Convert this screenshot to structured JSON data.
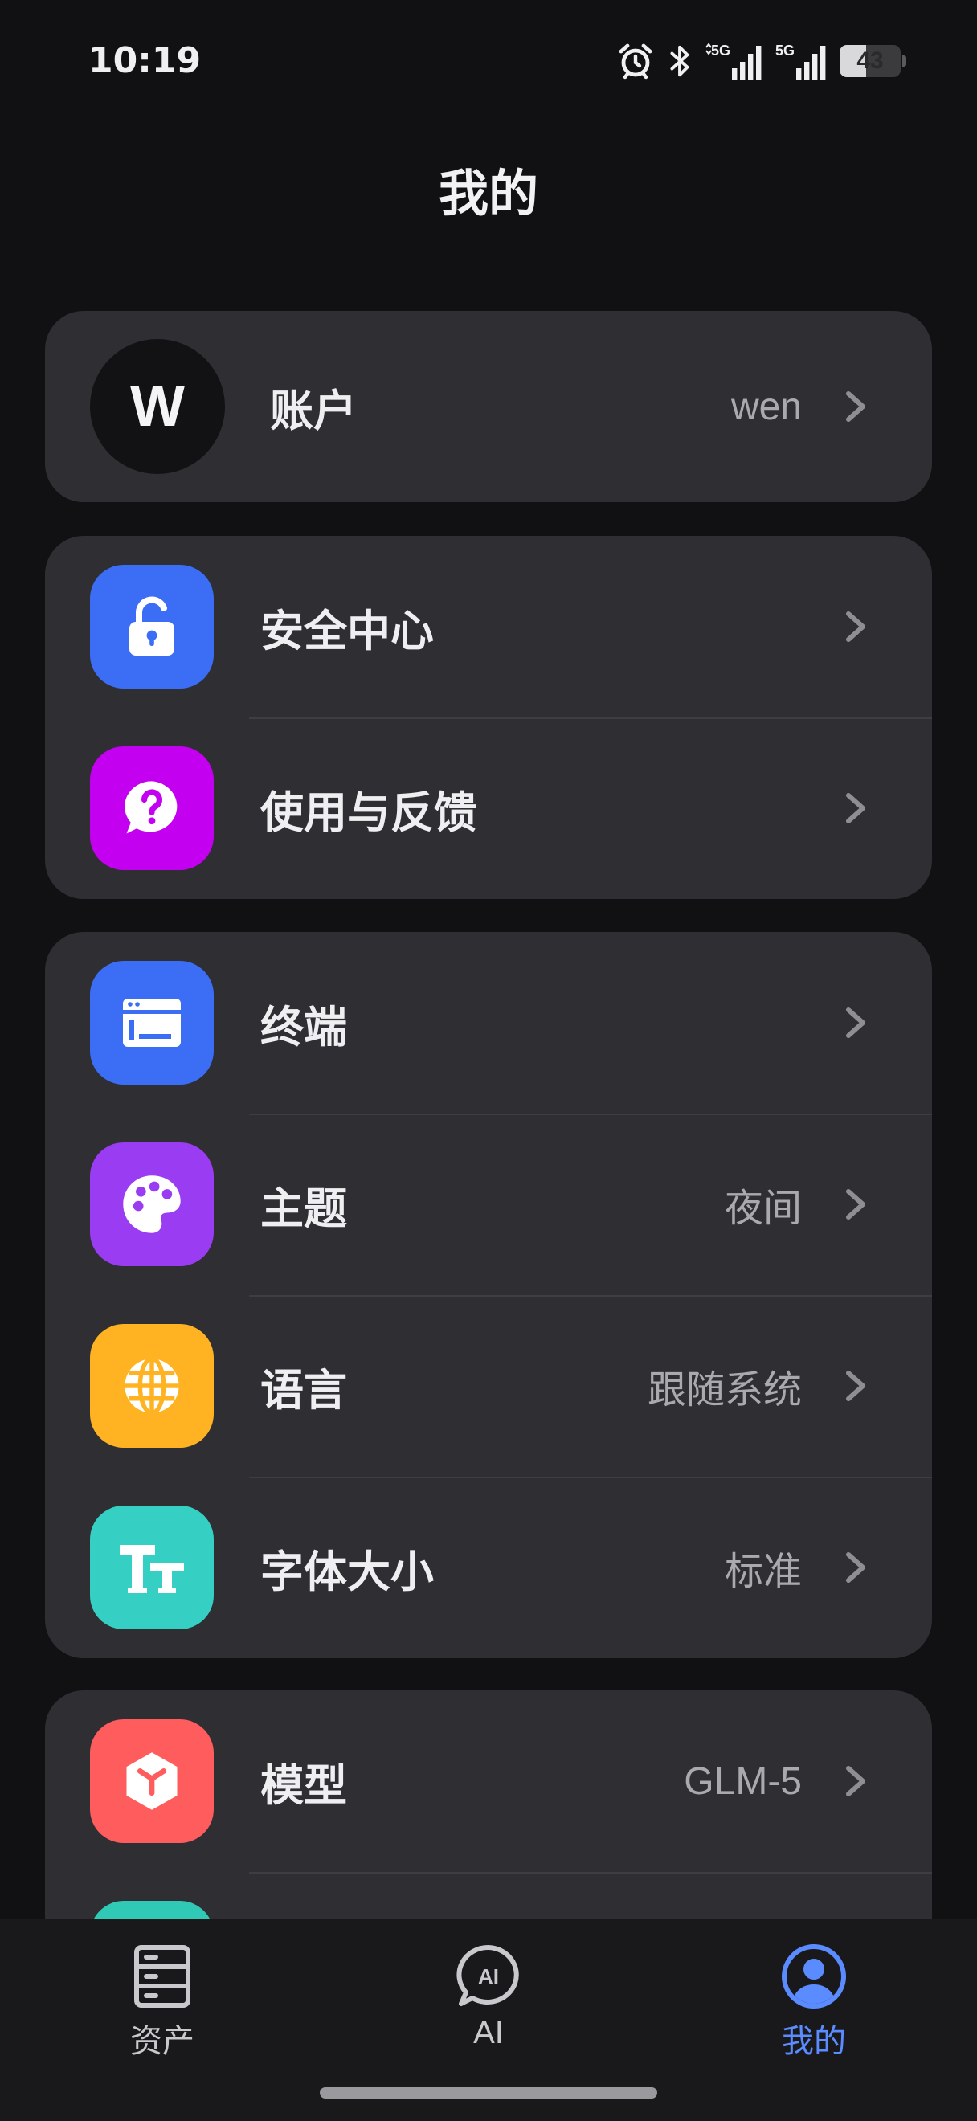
{
  "status_bar": {
    "time": "10:19",
    "battery_level": "43",
    "icons": [
      "alarm-icon",
      "bluetooth-icon",
      "signal-5g-icon",
      "signal-5g-icon",
      "battery-icon"
    ]
  },
  "page": {
    "title": "我的"
  },
  "account": {
    "avatar_letter": "W",
    "label": "账户",
    "value": "wen"
  },
  "groups": [
    {
      "items": [
        {
          "label": "安全中心",
          "value": "",
          "icon": "unlock-icon",
          "color": "#3b6ef5"
        },
        {
          "label": "使用与反馈",
          "value": "",
          "icon": "question-bubble-icon",
          "color": "#c400f0"
        }
      ]
    },
    {
      "items": [
        {
          "label": "终端",
          "value": "",
          "icon": "terminal-window-icon",
          "color": "#3b6ef5"
        },
        {
          "label": "主题",
          "value": "夜间",
          "icon": "palette-icon",
          "color": "#9a3cf2"
        },
        {
          "label": "语言",
          "value": "跟随系统",
          "icon": "globe-icon",
          "color": "#ffb322"
        },
        {
          "label": "字体大小",
          "value": "标准",
          "icon": "font-size-icon",
          "color": "#36cfc3"
        }
      ]
    },
    {
      "items": [
        {
          "label": "模型",
          "value": "GLM-5",
          "icon": "cube-icon",
          "color": "#ff5d5d"
        },
        {
          "icon": "partial-icon",
          "color": "#2fc9b5"
        }
      ]
    }
  ],
  "bottom_nav": {
    "items": [
      {
        "label": "资产",
        "icon": "server-stack-icon",
        "active": false
      },
      {
        "label": "AI",
        "icon": "ai-chat-icon",
        "active": false
      },
      {
        "label": "我的",
        "icon": "profile-icon",
        "active": true
      }
    ],
    "active_color": "#5b8cff"
  }
}
